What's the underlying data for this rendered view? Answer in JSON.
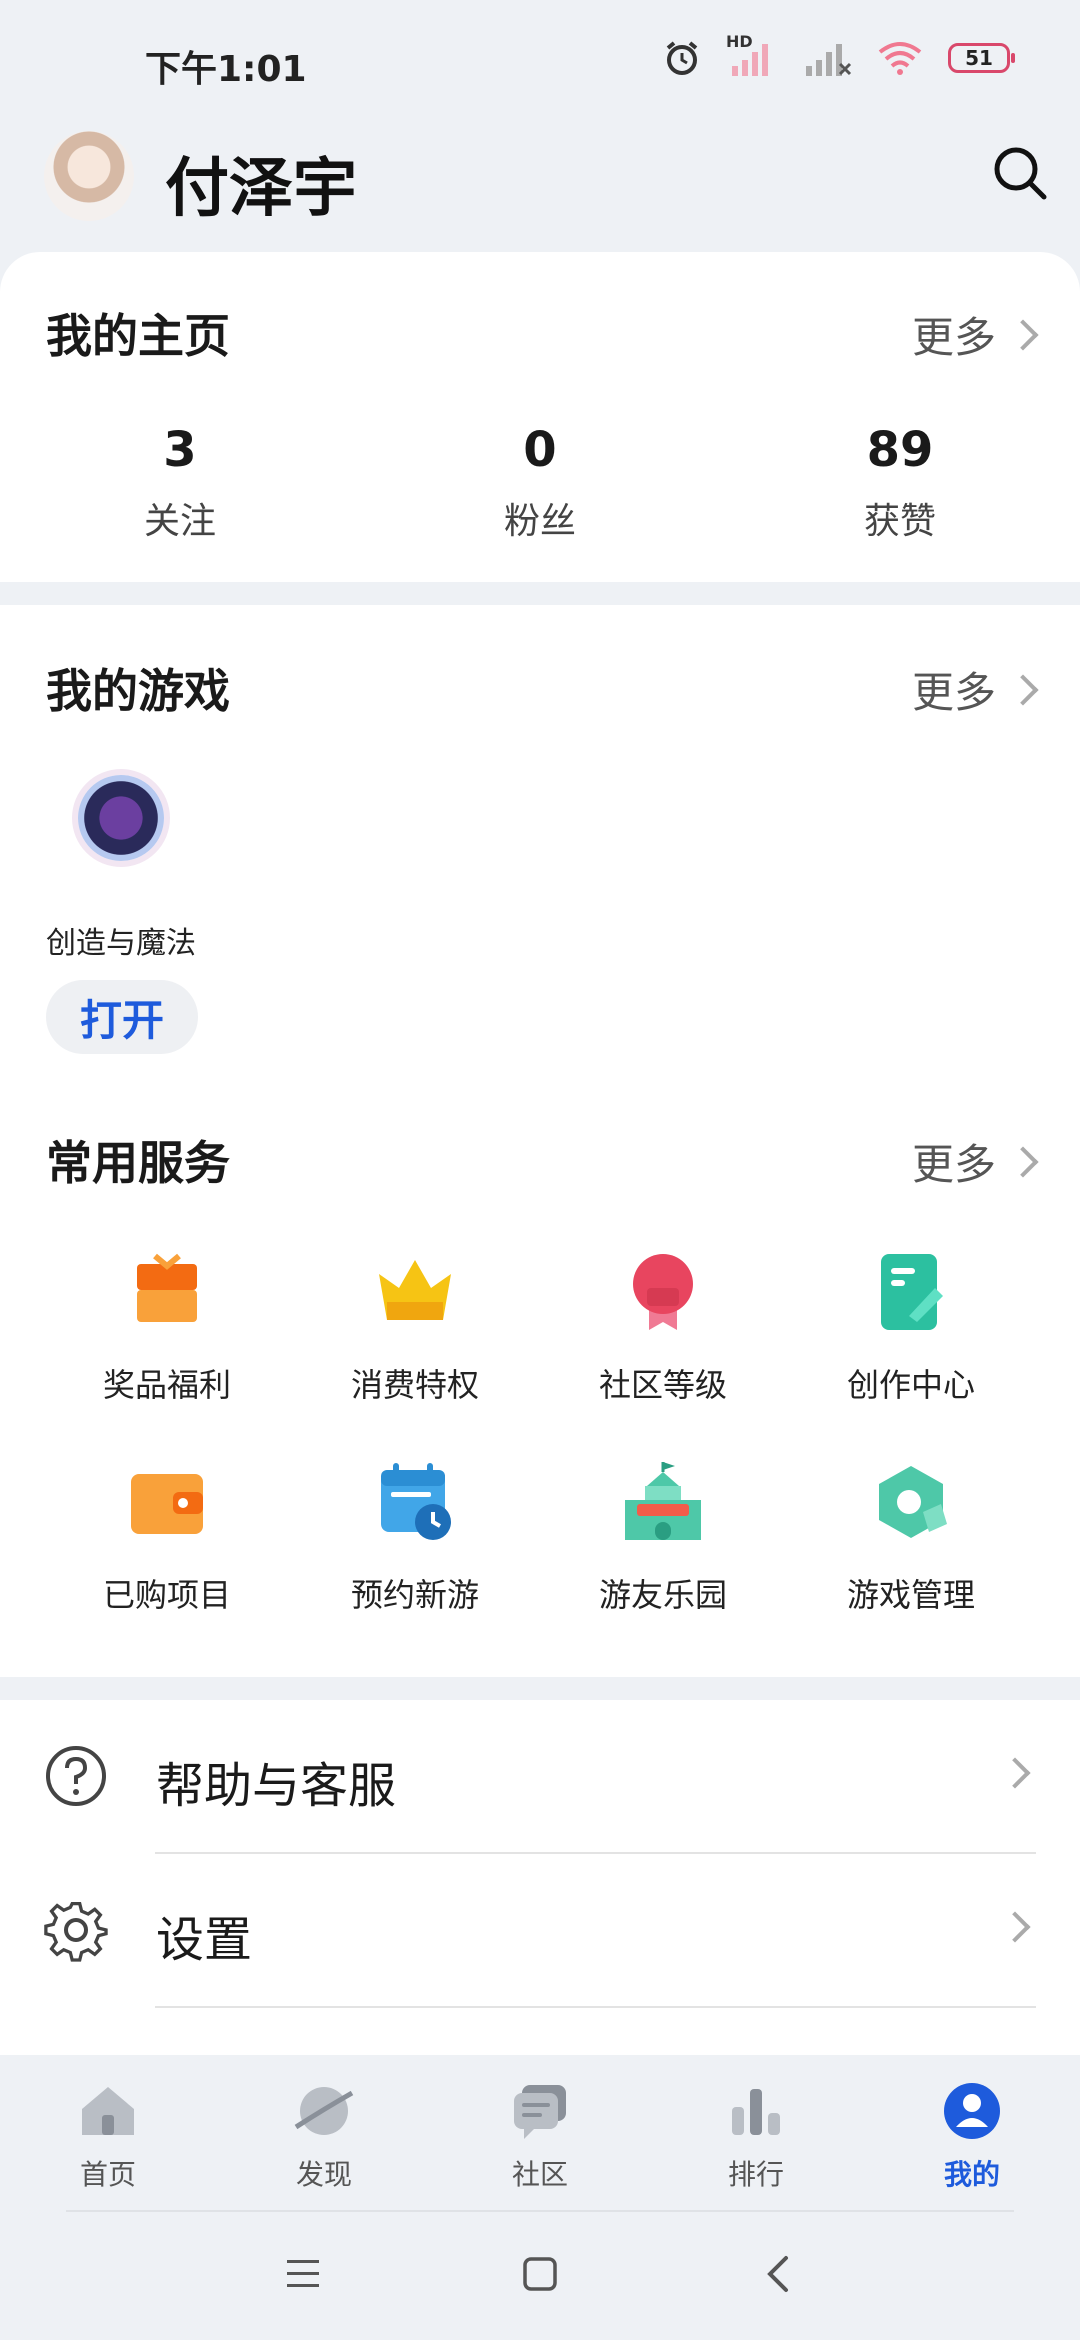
{
  "status": {
    "time": "下午1:01",
    "battery": "51",
    "hd_label": "HD"
  },
  "header": {
    "username": "付泽宇"
  },
  "homepage": {
    "title": "我的主页",
    "more_label": "更多",
    "stats": [
      {
        "value": "3",
        "label": "关注"
      },
      {
        "value": "0",
        "label": "粉丝"
      },
      {
        "value": "89",
        "label": "获赞"
      }
    ]
  },
  "games": {
    "title": "我的游戏",
    "more_label": "更多",
    "items": [
      {
        "name": "创造与魔法",
        "button": "打开"
      }
    ]
  },
  "services": {
    "title": "常用服务",
    "more_label": "更多",
    "items": [
      {
        "label": "奖品福利",
        "icon": "gift-icon"
      },
      {
        "label": "消费特权",
        "icon": "crown-icon"
      },
      {
        "label": "社区等级",
        "icon": "badge-icon"
      },
      {
        "label": "创作中心",
        "icon": "edit-document-icon"
      },
      {
        "label": "已购项目",
        "icon": "wallet-icon"
      },
      {
        "label": "预约新游",
        "icon": "calendar-clock-icon"
      },
      {
        "label": "游友乐园",
        "icon": "castle-icon"
      },
      {
        "label": "游戏管理",
        "icon": "hexagon-gear-icon"
      }
    ]
  },
  "menu": [
    {
      "label": "帮助与客服",
      "icon": "help-circle-icon"
    },
    {
      "label": "设置",
      "icon": "gear-icon"
    }
  ],
  "bottom_nav": [
    {
      "label": "首页",
      "icon": "home-icon",
      "active": false
    },
    {
      "label": "发现",
      "icon": "planet-icon",
      "active": false
    },
    {
      "label": "社区",
      "icon": "chat-icon",
      "active": false
    },
    {
      "label": "排行",
      "icon": "bar-chart-icon",
      "active": false
    },
    {
      "label": "我的",
      "icon": "user-icon",
      "active": true
    }
  ],
  "colors": {
    "accent": "#1e5bdc",
    "background": "#eef1f5"
  }
}
